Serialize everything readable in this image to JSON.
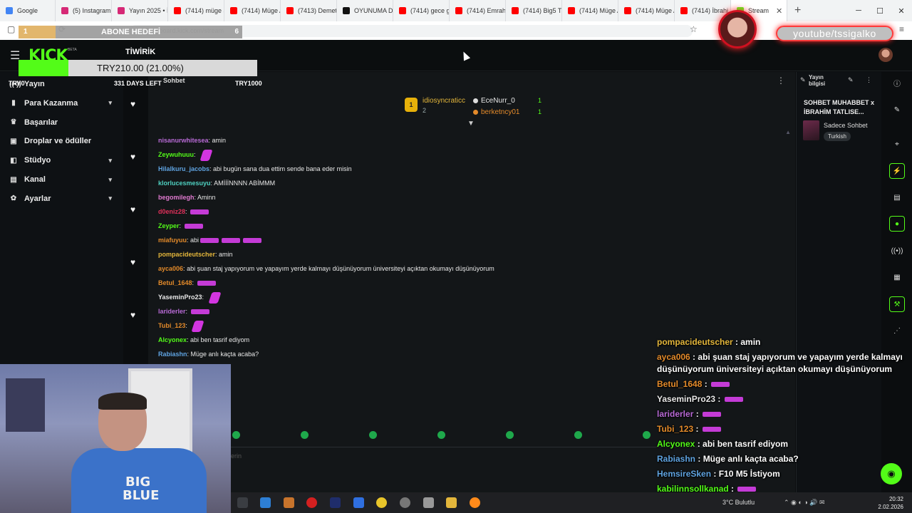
{
  "browser": {
    "tabs": [
      {
        "label": "Google",
        "color": "#4285f4"
      },
      {
        "label": "(5) Instagram",
        "color": "#d62976"
      },
      {
        "label": "Yayın 2025 • İr",
        "color": "#d62976"
      },
      {
        "label": "(7414) müge a",
        "color": "#ff0000"
      },
      {
        "label": "(7414) Müge A",
        "color": "#ff0000"
      },
      {
        "label": "(7413) Demet",
        "color": "#ff0000"
      },
      {
        "label": "OYUNUMA D",
        "color": "#111111"
      },
      {
        "label": "(7414) gece g",
        "color": "#ff0000"
      },
      {
        "label": "(7414) Emrah",
        "color": "#ff0000"
      },
      {
        "label": "(7414) Big5 Tü",
        "color": "#ff0000"
      },
      {
        "label": "(7414) Müge A",
        "color": "#ff0000"
      },
      {
        "label": "(7414) Müge A",
        "color": "#ff0000"
      },
      {
        "label": "(7414) İbrahi",
        "color": "#ff0000"
      },
      {
        "label": "Stream",
        "color": "#53fc18"
      }
    ],
    "url": "dashboard.kick.com/stream"
  },
  "kick": {
    "logo": "KICK",
    "beta": "BETA"
  },
  "sidebar": {
    "items": [
      {
        "label": "Yayın",
        "icon": "broadcast-icon",
        "chevron": false
      },
      {
        "label": "Para Kazanma",
        "icon": "money-icon",
        "chevron": true
      },
      {
        "label": "Başarılar",
        "icon": "trophy-icon",
        "chevron": false
      },
      {
        "label": "Droplar ve ödüller",
        "icon": "gift-icon",
        "chevron": false
      },
      {
        "label": "Stüdyo",
        "icon": "studio-icon",
        "chevron": true
      },
      {
        "label": "Kanal",
        "icon": "channel-icon",
        "chevron": true
      },
      {
        "label": "Ayarlar",
        "icon": "gear-icon",
        "chevron": true
      }
    ]
  },
  "chat": {
    "header_title": "Sohbet",
    "pinned": {
      "rank": "1",
      "top_name": "idiosyncraticc",
      "top_count": "2",
      "others": [
        {
          "name": "EceNurr_0",
          "count": "1",
          "color": "#e8e8e8"
        },
        {
          "name": "berketncy01",
          "count": "1",
          "color": "#e38a2a"
        }
      ]
    },
    "messages": [
      {
        "user": "nisanurwhitesea",
        "color": "#b86ad6",
        "text": "amin",
        "emote": ""
      },
      {
        "user": "Zeywuhuuu",
        "color": "#53fc18",
        "text": "",
        "emote": "big"
      },
      {
        "user": "Hilalkuru_jacobs",
        "color": "#5fa3e0",
        "text": "abi bugün sana dua ettim sende bana eder misin",
        "emote": ""
      },
      {
        "user": "klorlucesmesuyu",
        "color": "#4fd0c0",
        "text": "AMİİİNNNN ABİMMM",
        "emote": ""
      },
      {
        "user": "begomilegh",
        "color": "#e07ad0",
        "text": "Aminn",
        "emote": ""
      },
      {
        "user": "d0eniz28",
        "color": "#e0305a",
        "text": "",
        "emote": "small"
      },
      {
        "user": "Zeyper",
        "color": "#53fc18",
        "text": "",
        "emote": "small"
      },
      {
        "user": "miafuyuu",
        "color": "#e38a2a",
        "text": "abi",
        "emote": "triple"
      },
      {
        "user": "pompacideutscher",
        "color": "#e3b63b",
        "text": "amin",
        "emote": ""
      },
      {
        "user": "ayca006",
        "color": "#e38a2a",
        "text": "abi şuan staj yapıyorum ve yapayım yerde kalmayı düşünüyorum üniversiteyi açıktan okumayı düşünüyorum",
        "emote": ""
      },
      {
        "user": "Betul_1648",
        "color": "#e38a2a",
        "text": "",
        "emote": "small"
      },
      {
        "user": "YaseminPro23",
        "color": "#e8e8e8",
        "text": "",
        "emote": "big"
      },
      {
        "user": "lariderler",
        "color": "#b86ad6",
        "text": "",
        "emote": "small"
      },
      {
        "user": "Tubi_123",
        "color": "#e38a2a",
        "text": "",
        "emote": "big"
      },
      {
        "user": "Alcyonex",
        "color": "#53fc18",
        "text": "abi ben tasrif ediyom",
        "emote": ""
      },
      {
        "user": "Rabiashn",
        "color": "#5fa3e0",
        "text": "Müge anlı kaçta acaba?",
        "emote": ""
      }
    ],
    "input_placeholder": "erin"
  },
  "info_panel": {
    "title": "Yayın bilgisi",
    "stream_title": "SOHBET MUHABBET x İBRAHİM TATLISE...",
    "category": "Sadece Sohbet",
    "language": "Turkish"
  },
  "overlay": {
    "goal": {
      "left": "1",
      "title": "ABONE HEDEFİ",
      "right": "6",
      "progress": 0.167
    },
    "tip": {
      "title": "TİWİRİK",
      "amount": "TRY210.00 (21.00%)",
      "progress": 0.21,
      "left": "TRY0",
      "days": "331 DAYS LEFT",
      "right": "TRY1000"
    },
    "handle": "youtube/tssigalko",
    "chat": [
      {
        "user": "pompacideutscher",
        "color": "#e3b63b",
        "text": "amin"
      },
      {
        "user": "ayca006",
        "color": "#e38a2a",
        "text": "abi şuan staj yapıyorum ve yapayım yerde kalmayı düşünüyorum üniversiteyi açıktan okumayı düşünüyorum"
      },
      {
        "user": "Betul_1648",
        "color": "#e38a2a",
        "text": ""
      },
      {
        "user": "YaseminPro23",
        "color": "#e8e8e8",
        "text": ""
      },
      {
        "user": "lariderler",
        "color": "#b86ad6",
        "text": ""
      },
      {
        "user": "Tubi_123",
        "color": "#e38a2a",
        "text": ""
      },
      {
        "user": "Alcyonex",
        "color": "#53fc18",
        "text": "abi ben tasrif ediyom"
      },
      {
        "user": "Rabiashn",
        "color": "#5fa3e0",
        "text": "Müge anlı kaçta acaba?"
      },
      {
        "user": "HemsireSken",
        "color": "#5fa3e0",
        "text": "F10 M5 İstiyom"
      },
      {
        "user": "kabilinnsollkanad",
        "color": "#53fc18",
        "text": ""
      }
    ]
  },
  "webcam": {
    "shirt_line1": "BIG",
    "shirt_line2": "BLUE"
  },
  "taskbar": {
    "weather": "3°C Bulutlu",
    "time": "20:32",
    "date": "2.02.2026"
  }
}
